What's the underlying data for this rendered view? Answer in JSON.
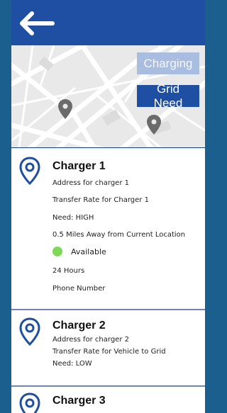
{
  "header": {
    "back_icon": "arrow-left-icon"
  },
  "map": {
    "buttons": {
      "charging": "Charging",
      "grid_need": "Grid Need"
    },
    "pins": [
      "map-pin-icon",
      "map-pin-icon"
    ]
  },
  "chargers": [
    {
      "name": "Charger 1",
      "address": "Address for charger 1",
      "transfer": "Transfer Rate for Charger 1",
      "need": "Need: HIGH",
      "distance": "0.5 Miles Away from Current Location",
      "status": "Available",
      "status_color": "#7ed957",
      "hours": "24 Hours",
      "phone": "Phone Number"
    },
    {
      "name": "Charger 2",
      "address": "Address for charger 2",
      "transfer": "Transfer Rate for Vehicle to Grid",
      "need": "Need: LOW"
    },
    {
      "name": "Charger 3"
    }
  ],
  "colors": {
    "primary": "#1f4fa3",
    "primary_light": "#a9bde0",
    "background_dark": "#0e3f7c",
    "available": "#7ed957"
  }
}
